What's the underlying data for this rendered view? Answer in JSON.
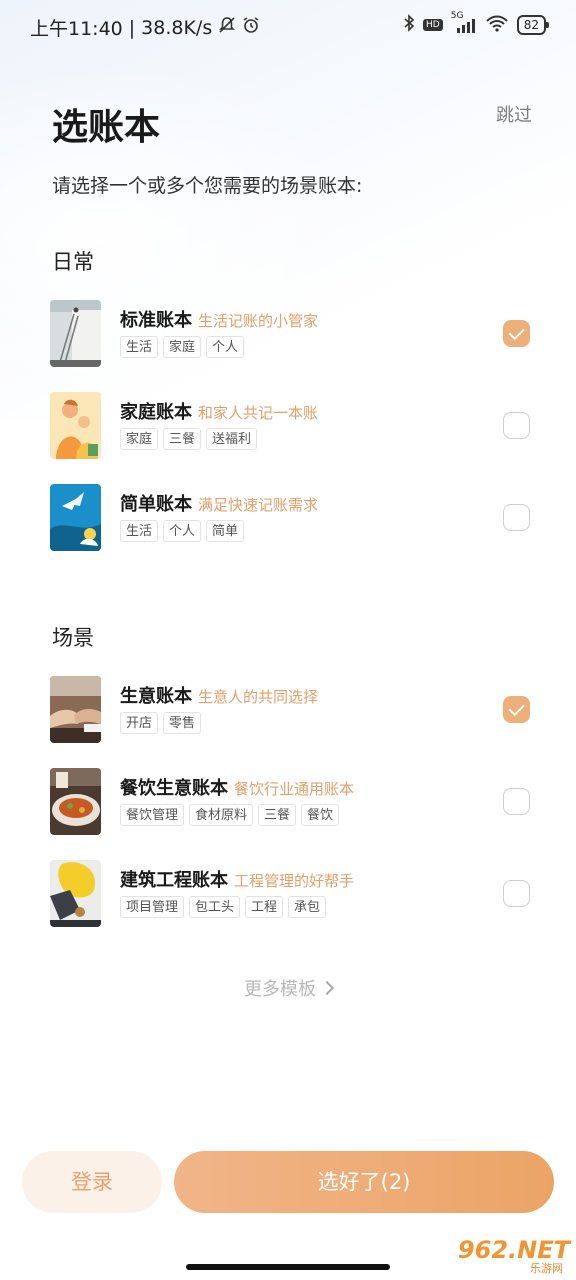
{
  "status_bar": {
    "time": "上午11:40",
    "speed": "38.8K/s",
    "hd": "HD",
    "network": "5G",
    "battery": "82"
  },
  "header": {
    "title": "选账本",
    "skip_label": "跳过",
    "subtitle": "请选择一个或多个您需要的场景账本:"
  },
  "sections": [
    {
      "title": "日常",
      "items": [
        {
          "name": "标准账本",
          "desc": "生活记账的小管家",
          "tags": [
            "生活",
            "家庭",
            "个人"
          ],
          "checked": true
        },
        {
          "name": "家庭账本",
          "desc": "和家人共记一本账",
          "tags": [
            "家庭",
            "三餐",
            "送福利"
          ],
          "checked": false
        },
        {
          "name": "简单账本",
          "desc": "满足快速记账需求",
          "tags": [
            "生活",
            "个人",
            "简单"
          ],
          "checked": false
        }
      ]
    },
    {
      "title": "场景",
      "items": [
        {
          "name": "生意账本",
          "desc": "生意人的共同选择",
          "tags": [
            "开店",
            "零售"
          ],
          "checked": true
        },
        {
          "name": "餐饮生意账本",
          "desc": "餐饮行业通用账本",
          "tags": [
            "餐饮管理",
            "食材原料",
            "三餐",
            "餐饮"
          ],
          "checked": false
        },
        {
          "name": "建筑工程账本",
          "desc": "工程管理的好帮手",
          "tags": [
            "项目管理",
            "包工头",
            "工程",
            "承包"
          ],
          "checked": false
        }
      ]
    }
  ],
  "more_templates_label": "更多模板",
  "footer": {
    "login_label": "登录",
    "confirm_label": "选好了(2)"
  },
  "watermark": {
    "main": "962.NET",
    "sub": "乐游网"
  },
  "colors": {
    "accent": "#eca466",
    "accent_light": "#fcf1e8",
    "desc_text": "#e3a06a"
  }
}
